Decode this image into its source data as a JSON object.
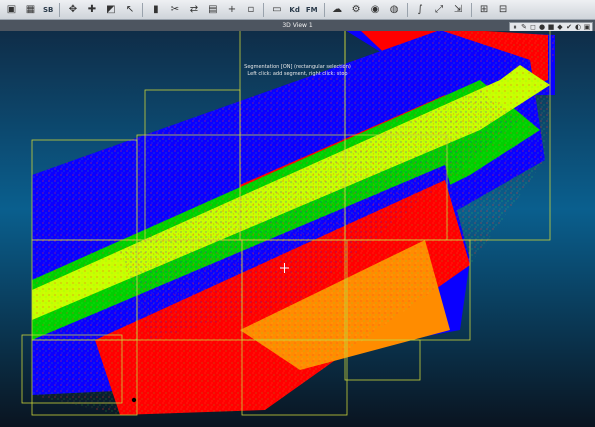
{
  "toolbar": {
    "items": [
      {
        "icon": "open-folder-icon",
        "glyph": "▣"
      },
      {
        "icon": "checker-icon",
        "glyph": "▦"
      },
      {
        "icon": "sf-icon",
        "glyph": "SB"
      },
      {
        "icon": "sep"
      },
      {
        "icon": "translate-icon",
        "glyph": "✥"
      },
      {
        "icon": "point-pick-icon",
        "glyph": "✚"
      },
      {
        "icon": "segment-icon",
        "glyph": "◩"
      },
      {
        "icon": "cursor-icon",
        "glyph": "↖"
      },
      {
        "icon": "sep"
      },
      {
        "icon": "bar-chart-icon",
        "glyph": "▮"
      },
      {
        "icon": "scissors-icon",
        "glyph": "✂"
      },
      {
        "icon": "merge-icon",
        "glyph": "⇄"
      },
      {
        "icon": "grid-icon",
        "glyph": "▤"
      },
      {
        "icon": "plus-icon",
        "glyph": "+"
      },
      {
        "icon": "box-icon",
        "glyph": "▫"
      },
      {
        "icon": "sep"
      },
      {
        "icon": "file-icon",
        "glyph": "▭"
      },
      {
        "icon": "kd-icon",
        "glyph": "Kd"
      },
      {
        "icon": "fm-icon",
        "glyph": "FM"
      },
      {
        "icon": "sep"
      },
      {
        "icon": "cloud-icon",
        "glyph": "☁"
      },
      {
        "icon": "gear-icon",
        "glyph": "⚙"
      },
      {
        "icon": "color-wheel-icon",
        "glyph": "◉"
      },
      {
        "icon": "globe-icon",
        "glyph": "◍"
      },
      {
        "icon": "sep"
      },
      {
        "icon": "curve-icon",
        "glyph": "∫"
      },
      {
        "icon": "vector-icon",
        "glyph": "⤢"
      },
      {
        "icon": "export-icon",
        "glyph": "⇲"
      },
      {
        "icon": "sep"
      },
      {
        "icon": "scale-icon",
        "glyph": "⊞"
      },
      {
        "icon": "sample-icon",
        "glyph": "⊟"
      }
    ],
    "text_labels": {
      "sf": "SB",
      "kd": "Kd",
      "fm": "FM"
    }
  },
  "view": {
    "title": "3D View 1",
    "message_line1": "Segmentation [ON] (rectangular selection)",
    "message_line2": "Left click: add segment, right click: stop",
    "tools": [
      "⏸",
      "✎",
      "◻",
      "●",
      "■",
      "◆",
      "✔",
      "◐",
      "▣"
    ]
  },
  "colors": {
    "blue": "#0a00ff",
    "red": "#ff0000",
    "yellow_green": "#c8ff00",
    "green": "#00d000",
    "lime": "#a0ff00",
    "orange": "#ff8c00",
    "tile_outline": "#c9d23a"
  }
}
